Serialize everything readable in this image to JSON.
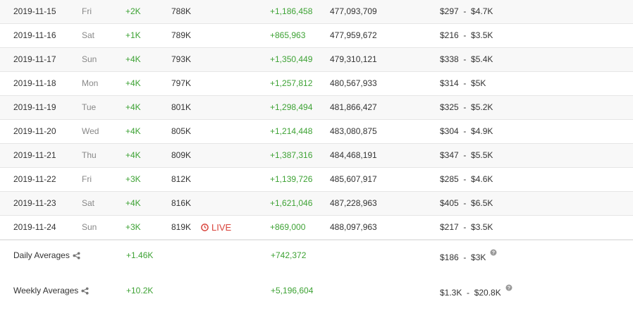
{
  "rows": [
    {
      "date": "2019-11-15",
      "day": "Fri",
      "subs_change": "+2K",
      "subs": "788K",
      "live": "",
      "views_change": "+1,186,458",
      "views": "477,093,709",
      "earnings": "$297  -  $4.7K"
    },
    {
      "date": "2019-11-16",
      "day": "Sat",
      "subs_change": "+1K",
      "subs": "789K",
      "live": "",
      "views_change": "+865,963",
      "views": "477,959,672",
      "earnings": "$216  -  $3.5K"
    },
    {
      "date": "2019-11-17",
      "day": "Sun",
      "subs_change": "+4K",
      "subs": "793K",
      "live": "",
      "views_change": "+1,350,449",
      "views": "479,310,121",
      "earnings": "$338  -  $5.4K"
    },
    {
      "date": "2019-11-18",
      "day": "Mon",
      "subs_change": "+4K",
      "subs": "797K",
      "live": "",
      "views_change": "+1,257,812",
      "views": "480,567,933",
      "earnings": "$314  -  $5K"
    },
    {
      "date": "2019-11-19",
      "day": "Tue",
      "subs_change": "+4K",
      "subs": "801K",
      "live": "",
      "views_change": "+1,298,494",
      "views": "481,866,427",
      "earnings": "$325  -  $5.2K"
    },
    {
      "date": "2019-11-20",
      "day": "Wed",
      "subs_change": "+4K",
      "subs": "805K",
      "live": "",
      "views_change": "+1,214,448",
      "views": "483,080,875",
      "earnings": "$304  -  $4.9K"
    },
    {
      "date": "2019-11-21",
      "day": "Thu",
      "subs_change": "+4K",
      "subs": "809K",
      "live": "",
      "views_change": "+1,387,316",
      "views": "484,468,191",
      "earnings": "$347  -  $5.5K"
    },
    {
      "date": "2019-11-22",
      "day": "Fri",
      "subs_change": "+3K",
      "subs": "812K",
      "live": "",
      "views_change": "+1,139,726",
      "views": "485,607,917",
      "earnings": "$285  -  $4.6K"
    },
    {
      "date": "2019-11-23",
      "day": "Sat",
      "subs_change": "+4K",
      "subs": "816K",
      "live": "",
      "views_change": "+1,621,046",
      "views": "487,228,963",
      "earnings": "$405  -  $6.5K"
    },
    {
      "date": "2019-11-24",
      "day": "Sun",
      "subs_change": "+3K",
      "subs": "819K",
      "live": "LIVE",
      "views_change": "+869,000",
      "views": "488,097,963",
      "earnings": "$217  -  $3.5K"
    }
  ],
  "daily_averages": {
    "label": "Daily Averages",
    "subs": "+1.46K",
    "views": "+742,372",
    "earnings": "$186  -  $3K"
  },
  "weekly_averages": {
    "label": "Weekly Averages",
    "subs": "+10.2K",
    "views": "+5,196,604",
    "earnings": "$1.3K  -  $20.8K"
  },
  "colors": {
    "positive": "#3da234",
    "live": "#d9443c",
    "muted": "#888888"
  },
  "icons": {
    "live": "clock-icon",
    "share": "share-icon",
    "help": "question-circle-icon"
  }
}
